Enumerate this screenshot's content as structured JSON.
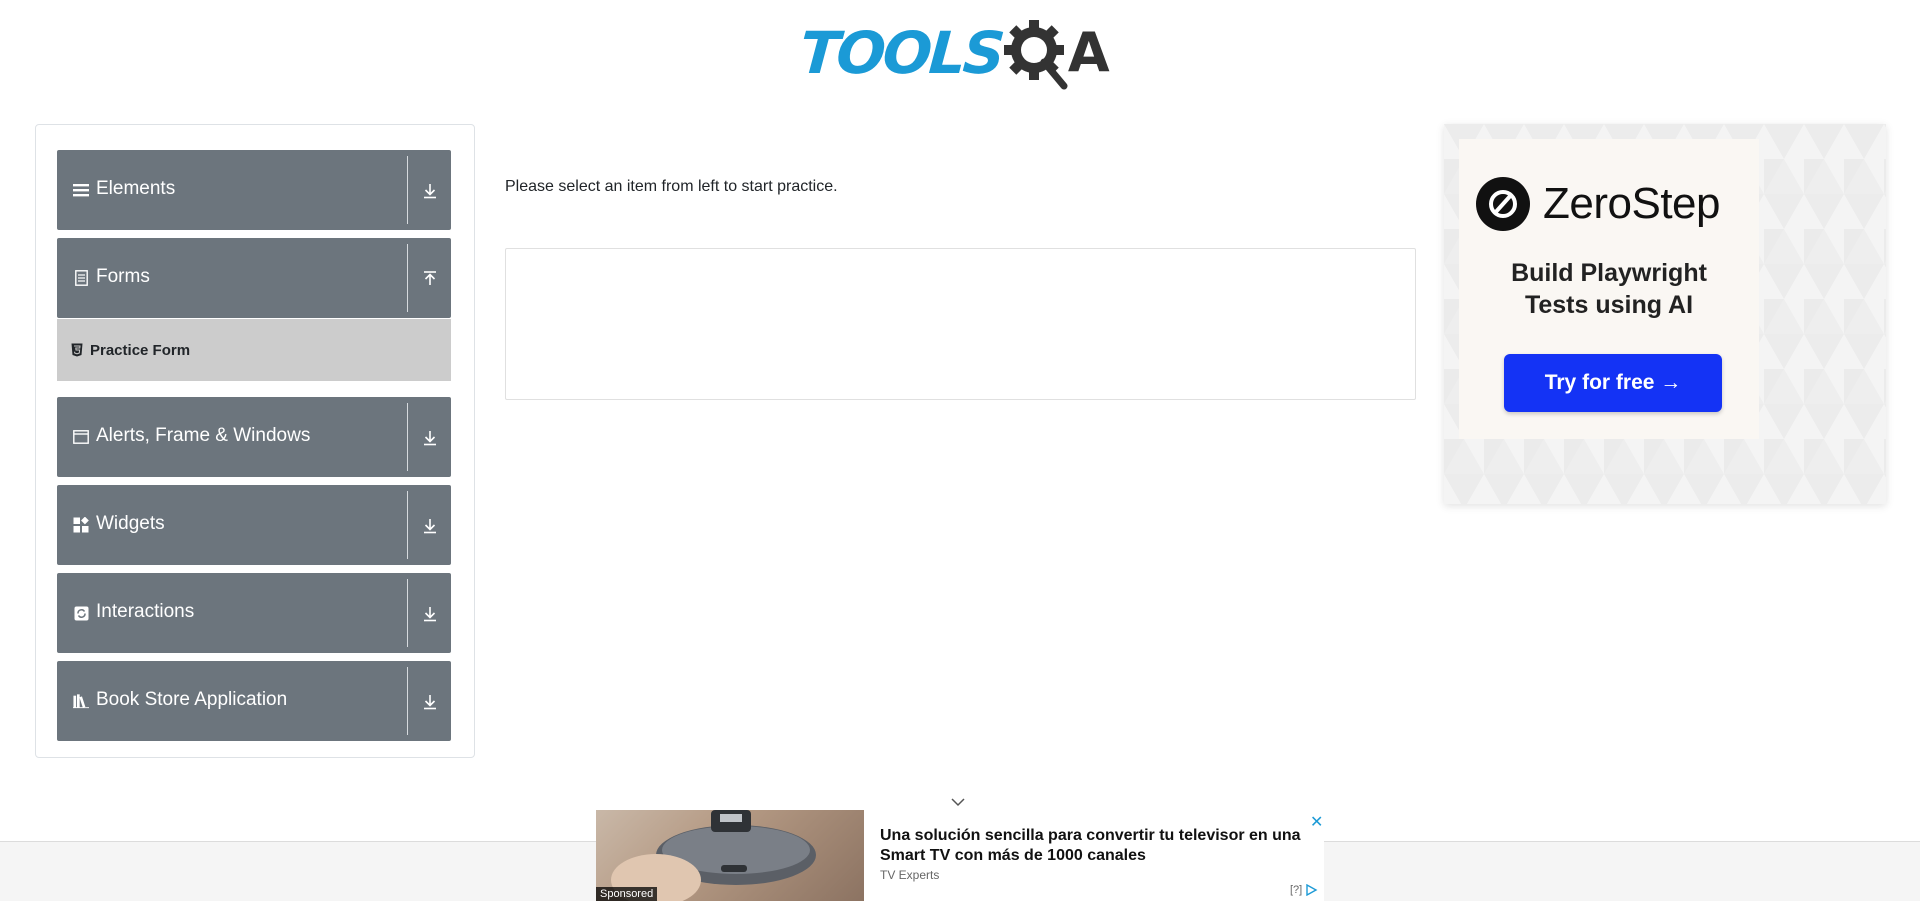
{
  "header": {
    "logo_text_tools": "TOOLS",
    "logo_text_a": "A"
  },
  "sidebar": {
    "groups": [
      {
        "label": "Elements",
        "icon": "hamburger-icon",
        "arrow": "download-arrow-icon"
      },
      {
        "label": "Forms",
        "icon": "document-icon",
        "arrow": "upload-arrow-icon"
      },
      {
        "label": "Alerts, Frame & Windows",
        "icon": "window-icon",
        "arrow": "download-arrow-icon"
      },
      {
        "label": "Widgets",
        "icon": "widgets-icon",
        "arrow": "download-arrow-icon"
      },
      {
        "label": "Interactions",
        "icon": "interactions-icon",
        "arrow": "download-arrow-icon"
      },
      {
        "label": "Book Store Application",
        "icon": "books-icon",
        "arrow": "download-arrow-icon"
      }
    ],
    "forms_sub_items": [
      {
        "label": "Practice Form",
        "icon": "html5-icon"
      }
    ]
  },
  "main": {
    "intro_text": "Please select an item from left to start practice."
  },
  "ad_right": {
    "brand": "ZeroStep",
    "tagline_line1": "Build Playwright",
    "tagline_line2": "Tests using AI",
    "cta": "Try for free →"
  },
  "ad_bottom": {
    "title": "Una solución sencilla para convertir tu televisor en una Smart TV con más de 1000 canales",
    "source": "TV Experts",
    "sponsored": "Sponsored",
    "close": "✕",
    "adchoices": "[?]"
  },
  "colors": {
    "sidebar_group_bg": "#6c757d",
    "sub_item_bg": "#cccccc",
    "logo_blue": "#1b9ad6",
    "cta_blue": "#1433f5"
  }
}
